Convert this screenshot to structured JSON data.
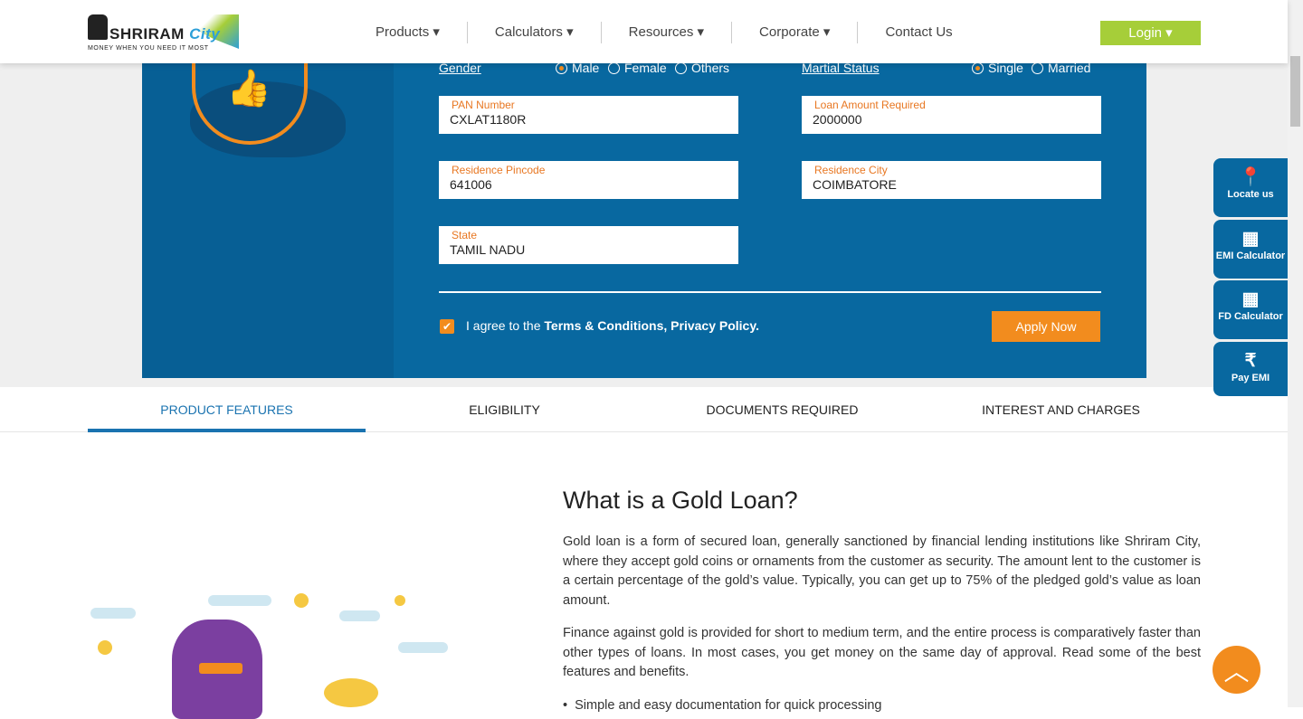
{
  "header": {
    "logo_name": "SHRIRAM",
    "logo_city": "City",
    "logo_tagline": "MONEY WHEN YOU NEED IT MOST",
    "nav": [
      "Products ▾",
      "Calculators ▾",
      "Resources ▾",
      "Corporate ▾",
      "Contact Us"
    ],
    "login": "Login ▾"
  },
  "form": {
    "gender_label": "Gender",
    "gender_options": [
      "Male",
      "Female",
      "Others"
    ],
    "gender_selected": "Male",
    "marital_label": "Martial Status",
    "marital_options": [
      "Single",
      "Married"
    ],
    "marital_selected": "Single",
    "fields": [
      {
        "label": "PAN Number",
        "value": "CXLAT1180R"
      },
      {
        "label": "Loan Amount Required",
        "value": "2000000"
      },
      {
        "label": "Residence Pincode",
        "value": "641006"
      },
      {
        "label": "Residence City",
        "value": "COIMBATORE"
      },
      {
        "label": "State",
        "value": "TAMIL NADU"
      }
    ],
    "agree_prefix": "I agree to the ",
    "agree_links": "Terms & Conditions, Privacy Policy.",
    "apply": "Apply Now"
  },
  "tabs": [
    "PRODUCT FEATURES",
    "ELIGIBILITY",
    "DOCUMENTS REQUIRED",
    "INTEREST AND CHARGES"
  ],
  "content": {
    "title": "What is a Gold Loan?",
    "p1": "Gold loan is a form of secured loan, generally sanctioned by financial lending institutions like Shriram City, where they accept gold coins or ornaments from the customer as security. The amount lent to the customer is a certain percentage of the gold’s value. Typically, you can get up to 75% of the pledged gold’s value as loan amount.",
    "p2": "Finance against gold is provided for short to medium term, and the entire process is comparatively faster than other types of loans. In most cases, you get money on the same day of approval. Read some of the best features and benefits.",
    "bullet": "Simple and easy documentation for quick processing"
  },
  "side": [
    "Locate us",
    "EMI Calculator",
    "FD Calculator",
    "Pay EMI"
  ],
  "colors": {
    "primary": "#0868a0",
    "accent": "#f28c1e",
    "login": "#a6ce39"
  }
}
